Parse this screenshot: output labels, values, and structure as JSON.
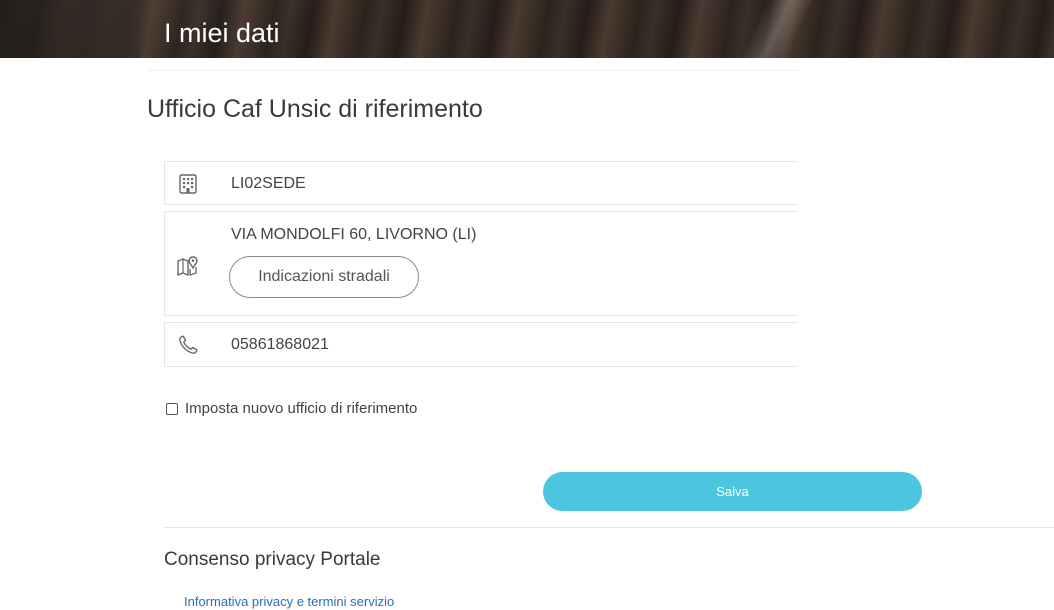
{
  "header": {
    "title": "I miei dati"
  },
  "office_section": {
    "title": "Ufficio Caf Unsic di riferimento",
    "office_code": "LI02SEDE",
    "office_code_icon": "building-icon",
    "address": "VIA MONDOLFI 60, LIVORNO (LI)",
    "address_icon": "map-pin-icon",
    "directions_label": "Indicazioni stradali",
    "phone": "05861868021",
    "phone_icon": "phone-icon"
  },
  "new_office": {
    "checked": false,
    "label": "Imposta nuovo ufficio di riferimento"
  },
  "save_label": "Salva",
  "privacy_section": {
    "title": "Consenso privacy Portale",
    "link_label": "Informativa privacy e termini servizio"
  },
  "colors": {
    "accent": "#4cc6e0",
    "link": "#2a6fb5"
  }
}
